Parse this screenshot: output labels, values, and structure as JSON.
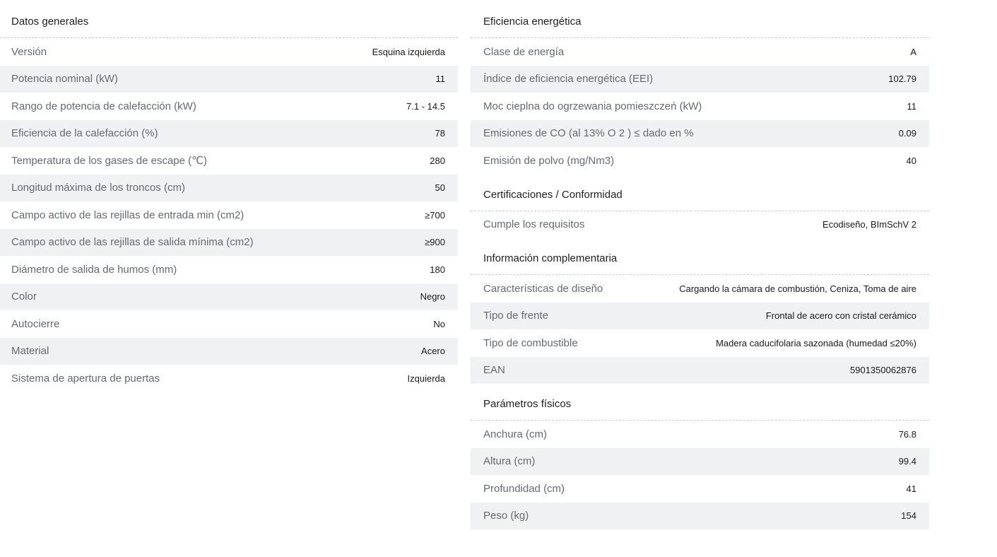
{
  "datos_generales": {
    "title": "Datos generales",
    "rows": [
      {
        "label": "Versión",
        "value": "Esquina izquierda"
      },
      {
        "label": "Potencia nominal (kW)",
        "value": "11"
      },
      {
        "label": "Rango de potencia de calefacción (kW)",
        "value": "7.1 - 14.5"
      },
      {
        "label": "Eficiencia de la calefacción (%)",
        "value": "78"
      },
      {
        "label": "Temperatura de los gases de escape (℃)",
        "value": "280"
      },
      {
        "label": "Longitud máxima de los troncos (cm)",
        "value": "50"
      },
      {
        "label": "Campo activo de las rejillas de entrada min (cm2)",
        "value": "≥700"
      },
      {
        "label": "Campo activo de las rejillas de salida mínima (cm2)",
        "value": "≥900"
      },
      {
        "label": "Diámetro de salida de humos (mm)",
        "value": "180"
      },
      {
        "label": "Color",
        "value": "Negro"
      },
      {
        "label": "Autocierre",
        "value": "No"
      },
      {
        "label": "Material",
        "value": "Acero"
      },
      {
        "label": "Sistema de apertura de puertas",
        "value": "Izquierda"
      }
    ]
  },
  "eficiencia": {
    "title": "Eficiencia energética",
    "rows": [
      {
        "label": "Clase de energía",
        "value": "A"
      },
      {
        "label": "Índice de eficiencia energética (EEI)",
        "value": "102.79"
      },
      {
        "label": "Moc cieplna do ogrzewania pomieszczeń (kW)",
        "value": "11"
      },
      {
        "label": "Emisiones de CO (al 13% O 2 ) ≤ dado en %",
        "value": "0.09"
      },
      {
        "label": "Emisión de polvo (mg/Nm3)",
        "value": "40"
      }
    ]
  },
  "certificaciones": {
    "title": "Certificaciones / Conformidad",
    "rows": [
      {
        "label": "Cumple los requisitos",
        "value": "Ecodiseño, BImSchV 2"
      }
    ]
  },
  "informacion": {
    "title": "Información complementaria",
    "rows": [
      {
        "label": "Características de diseño",
        "value": "Cargando la cámara de combustión, Ceniza, Toma de aire"
      },
      {
        "label": "Tipo de frente",
        "value": "Frontal de acero con cristal cerámico"
      },
      {
        "label": "Tipo de combustible",
        "value": "Madera caducifolaria sazonada (humedad ≤20%)"
      },
      {
        "label": "EAN",
        "value": "5901350062876"
      }
    ]
  },
  "fisicos": {
    "title": "Parámetros físicos",
    "rows": [
      {
        "label": "Anchura (cm)",
        "value": "76.8"
      },
      {
        "label": "Altura (cm)",
        "value": "99.4"
      },
      {
        "label": "Profundidad (cm)",
        "value": "41"
      },
      {
        "label": "Peso (kg)",
        "value": "154"
      }
    ]
  }
}
